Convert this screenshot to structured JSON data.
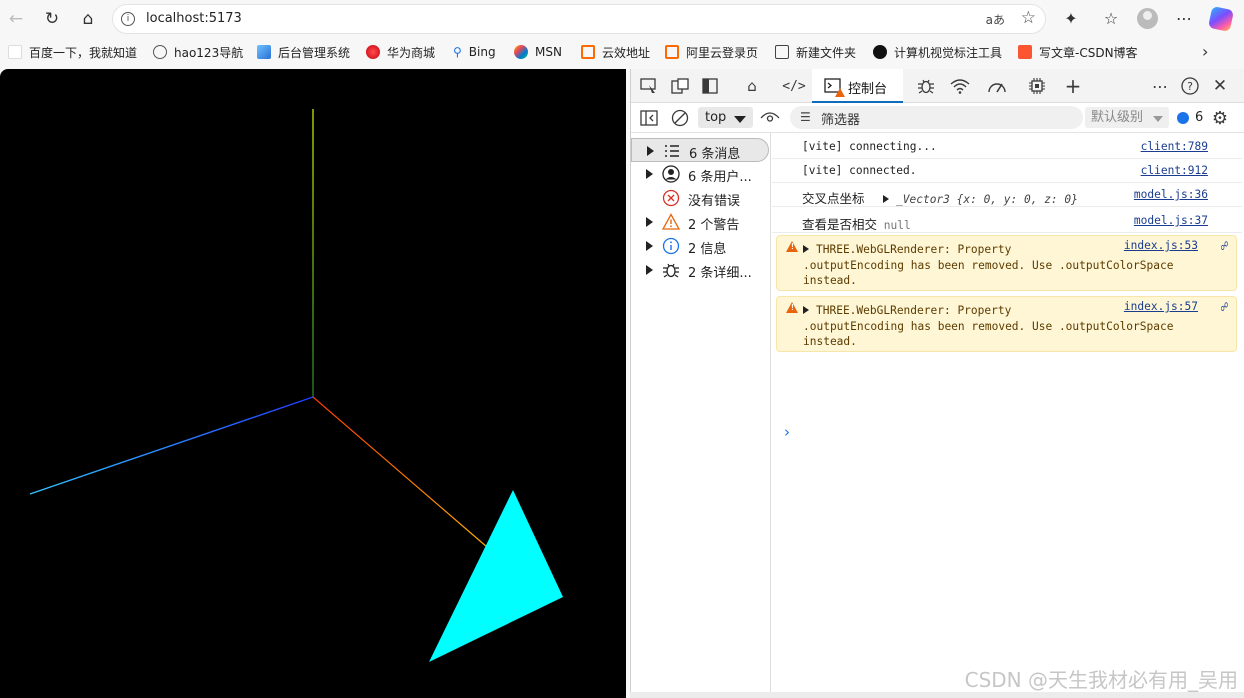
{
  "browser": {
    "url": "localhost:5173",
    "read_aloud_label": "aあ",
    "nav_icons": [
      "back-icon",
      "refresh-icon",
      "home-icon"
    ],
    "toolbar_icons": [
      "extensions-icon",
      "favorites-icon",
      "profile-icon",
      "more-icon",
      "copilot-icon"
    ]
  },
  "bookmarks": [
    {
      "label": "百度一下，我就知道",
      "color": "#ffffff"
    },
    {
      "label": "hao123导航",
      "color": "#ffffff"
    },
    {
      "label": "后台管理系统",
      "color": "#3b8beb"
    },
    {
      "label": "华为商城",
      "color": "#e60012"
    },
    {
      "label": "Bing",
      "color": "#1a73e8"
    },
    {
      "label": "MSN",
      "color": "#7c4dff"
    },
    {
      "label": "云效地址",
      "color": "#ff6a00"
    },
    {
      "label": "阿里云登录页",
      "color": "#ff6a00"
    },
    {
      "label": "新建文件夹",
      "color": "#444444"
    },
    {
      "label": "计算机视觉标注工具",
      "color": "#111111"
    },
    {
      "label": "写文章-CSDN博客",
      "color": "#fc5531"
    }
  ],
  "scene": {
    "background": "#000000",
    "triangle_color": "#00ffff",
    "axis_colors": {
      "x": "#ff8800",
      "y": "#88ff00",
      "z": "#1e90ff"
    }
  },
  "devtools": {
    "active_tab_label": "控制台",
    "context_select": "top",
    "filter_placeholder": "筛选器",
    "level_label": "默认级别",
    "message_count": "6",
    "sidebar": [
      {
        "label": "6 条消息",
        "icon": "list-icon",
        "expandable": true,
        "selected": true
      },
      {
        "label": "6 条用户...",
        "icon": "user-icon",
        "expandable": true,
        "selected": false
      },
      {
        "label": "没有错误",
        "icon": "error-icon",
        "expandable": false,
        "selected": false
      },
      {
        "label": "2 个警告",
        "icon": "warning-icon",
        "expandable": true,
        "selected": false
      },
      {
        "label": "2 信息",
        "icon": "info-icon",
        "expandable": true,
        "selected": false
      },
      {
        "label": "2 条详细...",
        "icon": "bug-icon",
        "expandable": true,
        "selected": false
      }
    ],
    "logs": [
      {
        "text": "[vite] connecting...",
        "source": "client:789"
      },
      {
        "text": "[vite] connected.",
        "source": "client:912"
      },
      {
        "label": "交叉点坐标",
        "value": "_Vector3 {x: 0, y: 0, z: 0}",
        "source": "model.js:36"
      },
      {
        "label": "查看是否相交",
        "value": "null",
        "source": "model.js:37"
      }
    ],
    "warnings": [
      {
        "line1": "THREE.WebGLRenderer: Property",
        "line2": ".outputEncoding has been removed. Use .outputColorSpace",
        "line3": "instead.",
        "source": "index.js:53"
      },
      {
        "line1": "THREE.WebGLRenderer: Property",
        "line2": ".outputEncoding has been removed. Use .outputColorSpace",
        "line3": "instead.",
        "source": "index.js:57"
      }
    ]
  },
  "watermark": "CSDN @天生我材必有用_吴用"
}
